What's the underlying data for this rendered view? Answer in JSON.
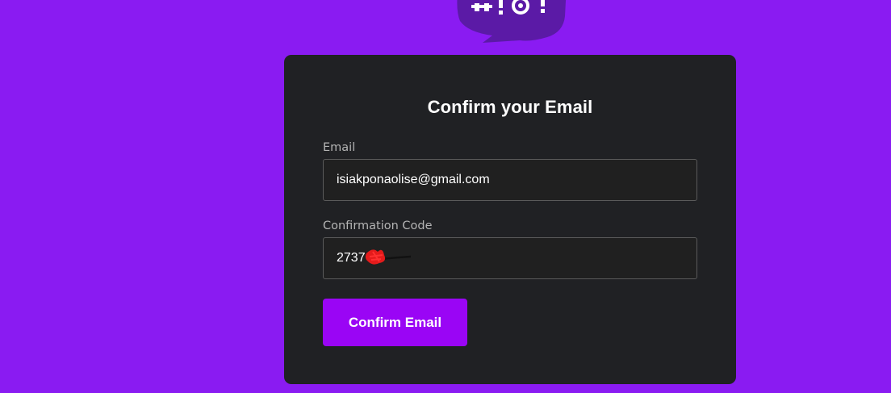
{
  "logo": {
    "icon": "speech-bubble-logo-icon",
    "color": "#5b1aa6"
  },
  "form": {
    "title": "Confirm your Email",
    "email": {
      "label": "Email",
      "value": "isiakponaolise@gmail.com"
    },
    "code": {
      "label": "Confirmation Code",
      "value": "2737"
    },
    "submit_label": "Confirm Email"
  },
  "colors": {
    "background": "#8a1bf2",
    "card": "#202124",
    "button": "#9a05f5"
  }
}
